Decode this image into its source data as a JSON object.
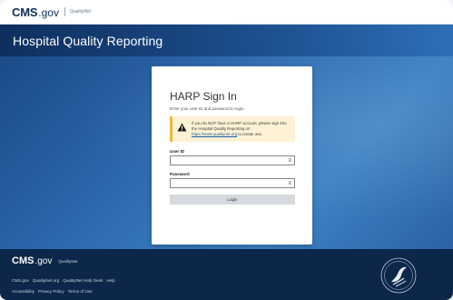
{
  "topbar": {
    "logo_cms": "CMS",
    "logo_gov": ".gov",
    "logo_sub": "QualityNet"
  },
  "header": {
    "title": "Hospital Quality Reporting"
  },
  "signin": {
    "title": "HARP Sign In",
    "subtitle": "Enter your user ID and password to login.",
    "alert_text": "If you do NOT have a HARP account, please sign into the Hospital Quality Reporting on",
    "alert_link": "https://www.qualitynet.org",
    "alert_suffix": "to create one.",
    "user_id_label": "User ID",
    "user_id_value": "",
    "password_label": "Password",
    "password_value": "",
    "field_icon": "≡",
    "login_label": "Login"
  },
  "footer": {
    "logo_cms": "CMS",
    "logo_gov": ".gov",
    "logo_sub": "QualityNet",
    "links_row1": [
      "CMS.gov",
      "QualityNet.org",
      "QualityNet Help Desk",
      "Help"
    ],
    "links_row2": [
      "Accessibility",
      "Privacy Policy",
      "Terms of Use"
    ]
  },
  "colors": {
    "brand_navy": "#0b2d5b",
    "alert_bg": "#fdf2d6",
    "alert_border": "#f2b634",
    "footer_bg": "#0c2749"
  }
}
